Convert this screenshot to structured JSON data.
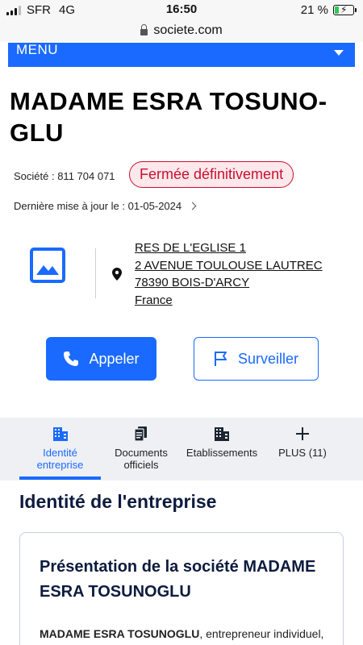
{
  "status_bar": {
    "carrier": "SFR",
    "network": "4G",
    "time": "16:50",
    "battery_percent": "21 %",
    "battery_level": 0.21,
    "charging_icon": "lightning-bolt"
  },
  "browser": {
    "url": "societe.com",
    "lock_icon": "lock-icon"
  },
  "menu": {
    "label": "MENU",
    "caret_icon": "chevron-down-icon"
  },
  "company": {
    "title_line1": "MADAME ESRA TOSUNO-",
    "title_line2": "GLU",
    "siren_label": "Société : 811 704 071",
    "status": "Fermée définitivement",
    "last_update": "Dernière mise à jour le : 01-05-2024"
  },
  "address": {
    "line1": "RES DE L'EGLISE 1",
    "line2": "2 AVENUE TOULOUSE LAUTREC",
    "line3": "78390 BOIS-D'ARCY",
    "line4": "France"
  },
  "actions": {
    "call_label": "Appeler",
    "watch_label": "Surveiller"
  },
  "tabs": [
    {
      "line1": "Identité",
      "line2": "entreprise",
      "icon": "building-icon",
      "active": true
    },
    {
      "line1": "Documents",
      "line2": "officiels",
      "icon": "documents-icon",
      "active": false
    },
    {
      "line1": "Etablissements",
      "line2": "",
      "icon": "buildings-icon",
      "active": false
    },
    {
      "line1": "PLUS (11)",
      "line2": "",
      "icon": "plus-icon",
      "active": false
    }
  ],
  "section": {
    "title": "Identité de l'entreprise"
  },
  "card": {
    "title_line1": "Présentation de la société MADAME",
    "title_line2": "ESRA TOSUNOGLU",
    "body_bold": "MADAME ESRA TOSUNOGLU",
    "body_rest": ", entrepreneur individuel,"
  },
  "colors": {
    "accent": "#1a6aff",
    "danger": "#c8102e",
    "danger_bg": "#fde8ec",
    "heading": "#0d1b3e"
  }
}
